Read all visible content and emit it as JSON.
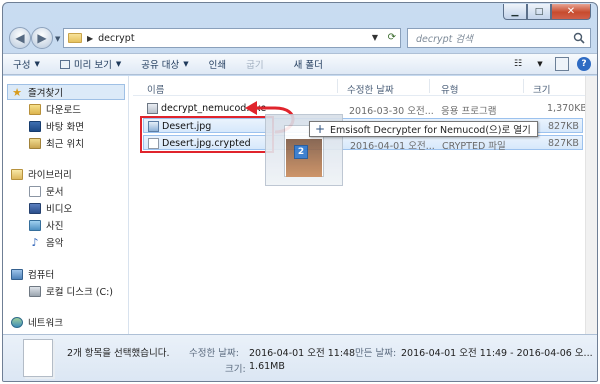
{
  "window": {
    "address": {
      "folder": "decrypt"
    },
    "search": {
      "placeholder": "decrypt 검색"
    }
  },
  "toolbar": {
    "organize": "구성",
    "preview": "미리 보기",
    "share": "공유 대상",
    "print": "인쇄",
    "burn": "굽기",
    "new_folder": "새 폴더"
  },
  "sidebar": {
    "favorites": "즐겨찾기",
    "downloads": "다운로드",
    "desktop": "바탕 화면",
    "recent": "최근 위치",
    "libraries": "라이브러리",
    "documents": "문서",
    "videos": "비디오",
    "pictures": "사진",
    "music": "음악",
    "computer": "컴퓨터",
    "local_disk": "로컬 디스크 (C:)",
    "network": "네트워크"
  },
  "columns": {
    "name": "이름",
    "date": "수정한 날짜",
    "type": "유형",
    "size": "크기"
  },
  "files": [
    {
      "name": "decrypt_nemucod.exe",
      "date": "2016-03-30 오전...",
      "type": "응용 프로그램",
      "size": "1,370KB"
    },
    {
      "name": "Desert.jpg",
      "date": "",
      "type": "",
      "size": "827KB"
    },
    {
      "name": "Desert.jpg.crypted",
      "date": "2016-04-01 오전...",
      "type": "CRYPTED 파일",
      "size": "827KB"
    }
  ],
  "drag": {
    "count": "2",
    "tooltip": "Emsisoft Decrypter for Nemucod(으)로 열기"
  },
  "status": {
    "selected": "2개 항목을 선택했습니다.",
    "modified_label": "수정한 날짜:",
    "modified_value": "2016-04-01 오전 11:48",
    "created_label": "만든 날짜:",
    "created_value": "2016-04-01 오전 11:49 - 2016-04-06 오...",
    "size_label": "크기:",
    "size_value": "1.61MB"
  },
  "colors": {
    "highlight_red": "#e0242c",
    "selection_blue": "#9cc2ee"
  }
}
